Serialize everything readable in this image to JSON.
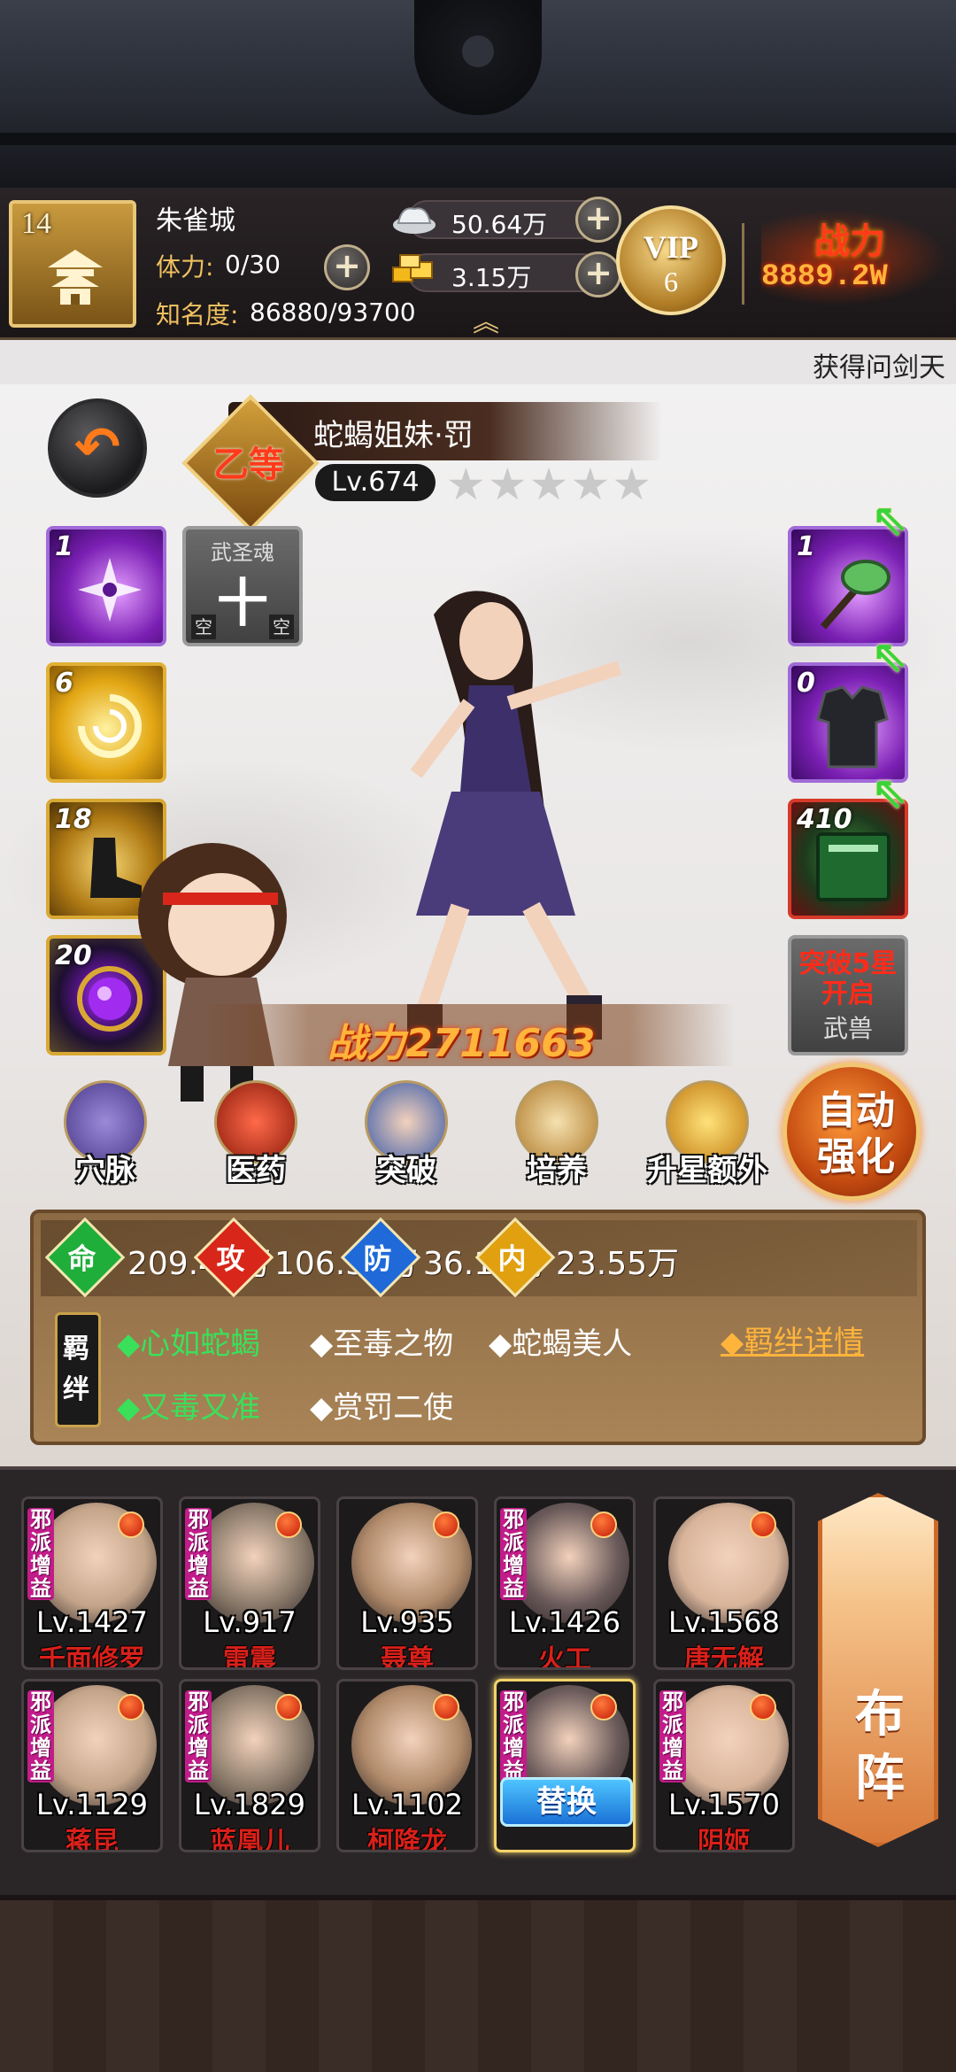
{
  "header": {
    "city_level": "14",
    "city_name": "朱雀城",
    "stamina_label": "体力:",
    "stamina_value": "0/30",
    "fame_label": "知名度:",
    "fame_value": "86880/93700",
    "silver": "50.64万",
    "gold": "3.15万",
    "vip_label": "VIP",
    "vip_level": "6",
    "power_label": "战力",
    "power_value": "8889.2W"
  },
  "marquee_text": "获得问剑天",
  "hero": {
    "name": "蛇蝎姐妹·罚",
    "rank": "乙等",
    "level": "Lv.674",
    "stars": "★★★★★",
    "star_count": 0,
    "power_text": "战力2711663"
  },
  "left_slots": [
    {
      "count": "1"
    },
    {
      "count": "6"
    },
    {
      "count": "18"
    },
    {
      "count": "20"
    }
  ],
  "soul_slot": {
    "title": "武圣魂",
    "glyph": "十",
    "empty_left": "空",
    "empty_right": "空"
  },
  "right_slots": [
    {
      "count": "1"
    },
    {
      "count": "0"
    },
    {
      "count": "410"
    }
  ],
  "beast_slot": {
    "locked_text": "突破5星开启",
    "label": "武兽"
  },
  "functions": [
    {
      "label": "穴脉"
    },
    {
      "label": "医药"
    },
    {
      "label": "突破"
    },
    {
      "label": "培养"
    },
    {
      "label": "升星额外"
    }
  ],
  "auto_button": "自动强化",
  "stats": [
    {
      "icon": "命",
      "value": "209.49万",
      "color": "#1fae3a"
    },
    {
      "icon": "攻",
      "value": "106.38万",
      "color": "#d8261a"
    },
    {
      "icon": "防",
      "value": "36.11万",
      "color": "#1f6ad8"
    },
    {
      "icon": "内",
      "value": "23.55万",
      "color": "#e0a010"
    }
  ],
  "bond": {
    "seal": "羁绊",
    "items": [
      {
        "text": "◆心如蛇蝎",
        "active": true
      },
      {
        "text": "◆至毒之物",
        "active": false
      },
      {
        "text": "◆蛇蝎美人",
        "active": false
      },
      {
        "text": "◆又毒又准",
        "active": true
      },
      {
        "text": "◆赏罚二使",
        "active": false
      }
    ],
    "detail_link": "◆羁绊详情"
  },
  "roster": {
    "tag": "邪派增益",
    "swap_label": "替换",
    "formation_label": "布阵",
    "cards": [
      {
        "level": "Lv.1427",
        "name": "千面修罗",
        "tag": true
      },
      {
        "level": "Lv.917",
        "name": "雷震",
        "tag": true
      },
      {
        "level": "Lv.935",
        "name": "聂尊",
        "tag": false
      },
      {
        "level": "Lv.1426",
        "name": "火工",
        "tag": true
      },
      {
        "level": "Lv.1568",
        "name": "唐无解",
        "tag": false
      },
      {
        "level": "Lv.1129",
        "name": "蒋昆",
        "tag": true
      },
      {
        "level": "Lv.1829",
        "name": "蓝凰儿",
        "tag": true
      },
      {
        "level": "Lv.1102",
        "name": "柯降龙",
        "tag": false
      },
      {
        "level": "",
        "name": "",
        "tag": true,
        "selected": true
      },
      {
        "level": "Lv.1570",
        "name": "阴姬",
        "tag": true
      }
    ]
  }
}
